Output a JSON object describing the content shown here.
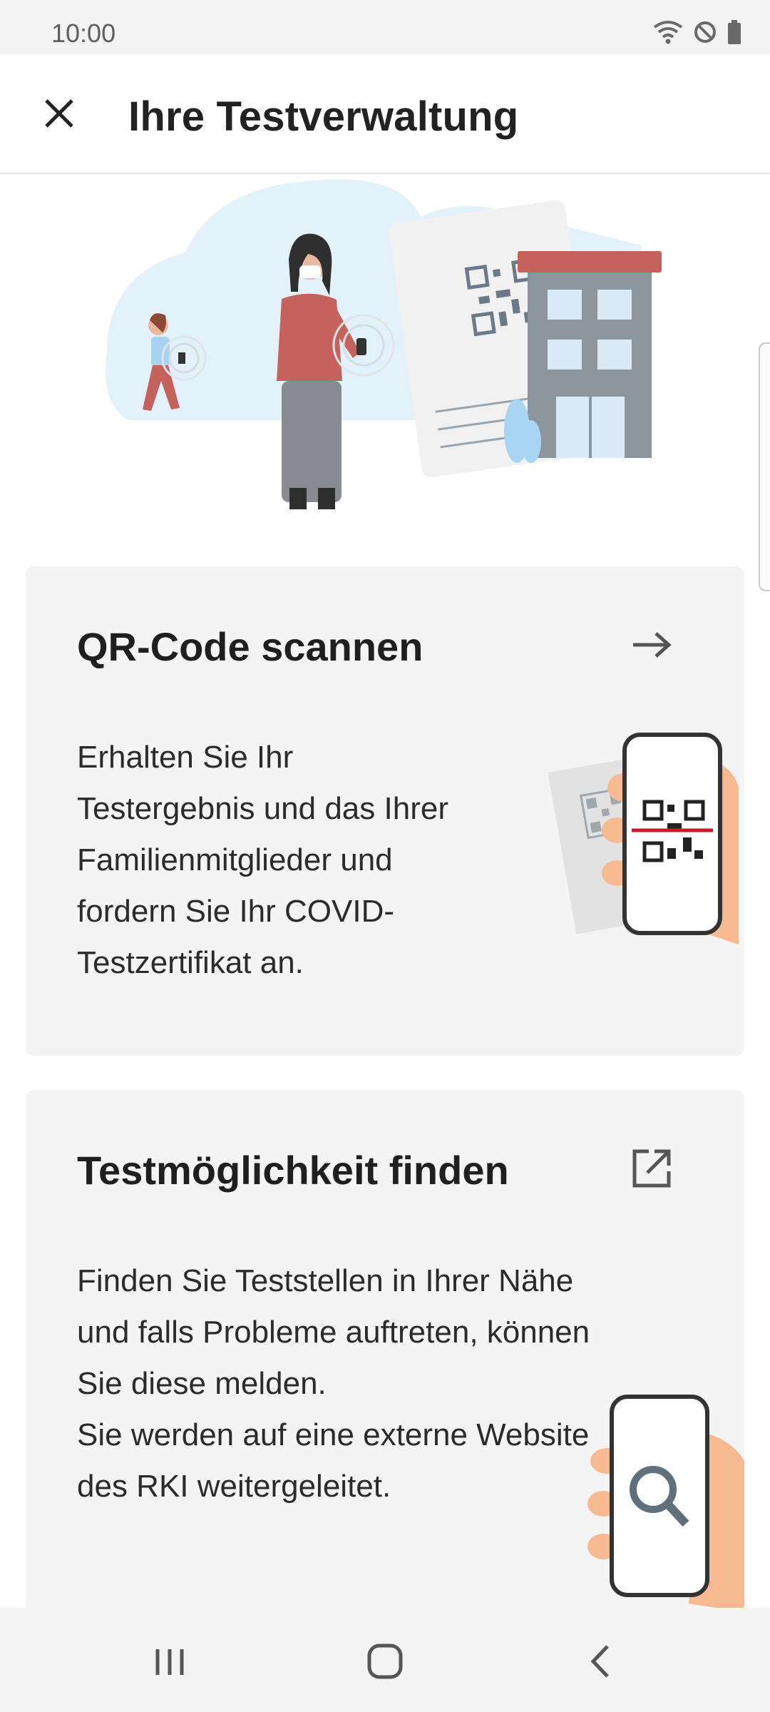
{
  "status_bar": {
    "time": "10:00",
    "icons": [
      "wifi-icon",
      "do-not-disturb-icon",
      "battery-icon"
    ]
  },
  "app_bar": {
    "title": "Ihre Testverwaltung",
    "close_icon": "close-icon"
  },
  "hero": {
    "illustration": "test-management-illustration"
  },
  "cards": [
    {
      "title": "QR-Code scannen",
      "text": "Erhalten Sie Ihr Testergebnis und das Ihrer Familienmitglieder und fordern Sie Ihr COVID-Testzertifikat an.",
      "action_icon": "arrow-right-icon",
      "illustration": "qr-scan-phone-illustration"
    },
    {
      "title": "Testmöglichkeit finden",
      "text": "Finden Sie Teststellen in Ihrer Nähe und falls Probleme auftreten, können Sie diese melden.\nSie werden auf eine externe Website des RKI weitergeleitet.",
      "action_icon": "external-link-icon",
      "illustration": "search-phone-illustration"
    }
  ],
  "nav_bar": {
    "recents": "recents-icon",
    "home": "home-icon",
    "back": "back-icon"
  },
  "colors": {
    "accent_red": "#c4625b",
    "card_bg": "#f4f4f4",
    "sky": "#e3f1fb",
    "building": "#8a959d"
  }
}
